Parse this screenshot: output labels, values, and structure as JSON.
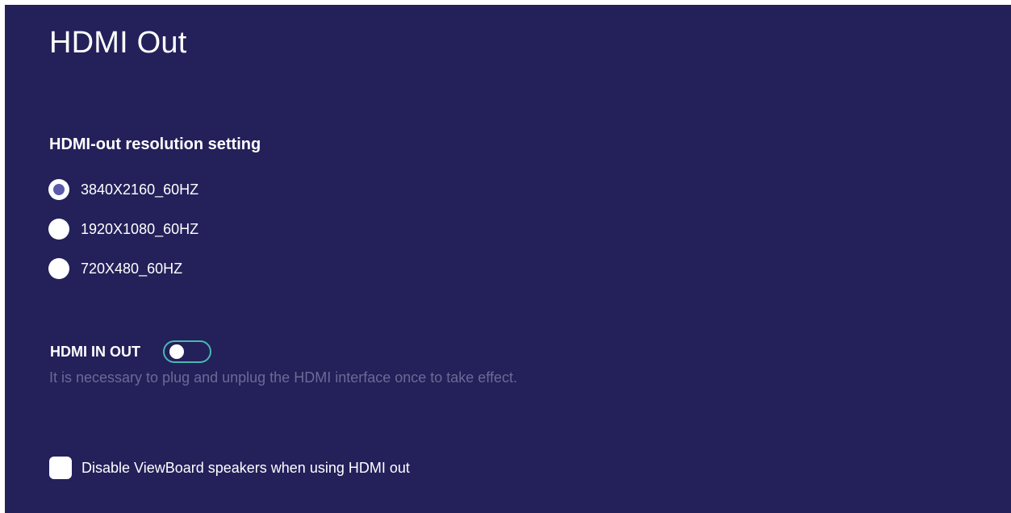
{
  "page": {
    "title": "HDMI Out"
  },
  "resolution": {
    "heading": "HDMI-out resolution setting",
    "options": [
      {
        "label": "3840X2160_60HZ",
        "selected": true
      },
      {
        "label": "1920X1080_60HZ",
        "selected": false
      },
      {
        "label": "720X480_60HZ",
        "selected": false
      }
    ]
  },
  "hdmi_in_out": {
    "label": "HDMI IN OUT",
    "enabled": false,
    "hint": "It is necessary to plug and unplug the HDMI interface once to take effect."
  },
  "speakers": {
    "label": "Disable ViewBoard speakers when using HDMI out",
    "checked": false
  },
  "colors": {
    "background": "#23205a",
    "radio_selected_dot": "#5c5aa8",
    "toggle_border": "#49b8b2",
    "hint_text": "#6c6a96"
  }
}
